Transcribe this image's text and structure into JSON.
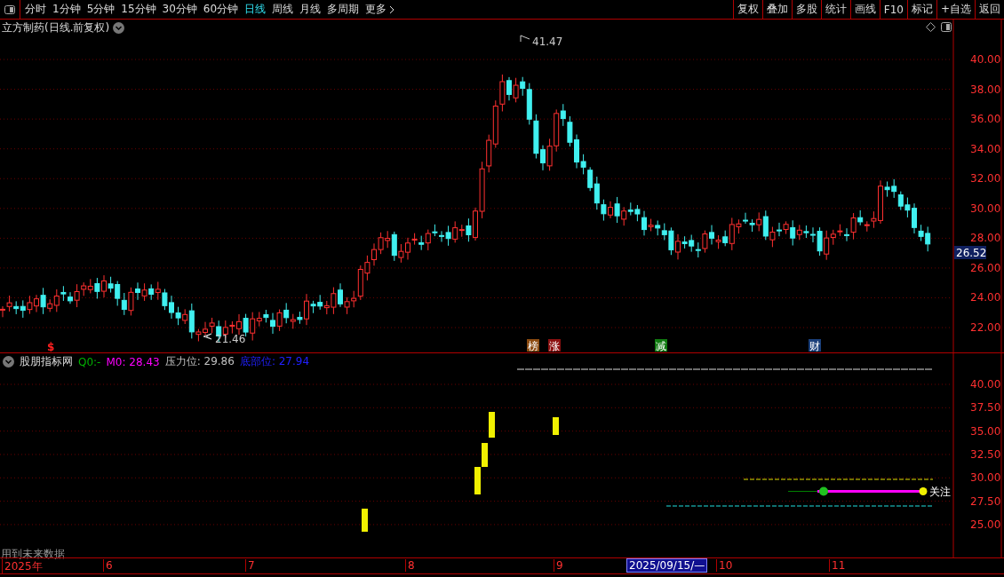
{
  "toolbar": {
    "periods": [
      {
        "label": "分时",
        "selected": false
      },
      {
        "label": "1分钟",
        "selected": false
      },
      {
        "label": "5分钟",
        "selected": false
      },
      {
        "label": "15分钟",
        "selected": false
      },
      {
        "label": "30分钟",
        "selected": false
      },
      {
        "label": "60分钟",
        "selected": false
      },
      {
        "label": "日线",
        "selected": true
      },
      {
        "label": "周线",
        "selected": false
      },
      {
        "label": "月线",
        "selected": false
      },
      {
        "label": "多周期",
        "selected": false
      },
      {
        "label": "更多",
        "selected": false
      }
    ],
    "buttons": [
      "复权",
      "叠加",
      "多股",
      "统计",
      "画线",
      "F10",
      "标记",
      "+自选",
      "返回"
    ]
  },
  "main_chart": {
    "title": "立方制药(日线.前复权)",
    "y_labels": [
      "40.00",
      "38.00",
      "36.00",
      "34.00",
      "32.00",
      "30.00",
      "28.00",
      "26.00",
      "24.00",
      "22.00"
    ],
    "current_price": "26.52",
    "high_label": "41.47",
    "low_label": "21.46",
    "marks": [
      {
        "text": "$",
        "kind": "symbol",
        "color": "#ff2020"
      },
      {
        "text": "榜",
        "kind": "badge",
        "color": "#8b4a10"
      },
      {
        "text": "涨",
        "kind": "badge",
        "color": "#8b1010"
      },
      {
        "text": "减",
        "kind": "badge",
        "color": "#107a10"
      },
      {
        "text": "财",
        "kind": "badge",
        "color": "#1a3f7a"
      }
    ]
  },
  "indicator": {
    "name": "股朋指标网",
    "legend": [
      {
        "text": "Q0:-",
        "color": "#00b000"
      },
      {
        "text": "M0: 28.43",
        "color": "#ff00ff"
      },
      {
        "text": "压力位: 29.86",
        "color": "#c0c0c0"
      },
      {
        "text": "底部位: 27.94",
        "color": "#2020ff"
      }
    ],
    "y_labels": [
      "40.00",
      "37.50",
      "35.00",
      "32.50",
      "30.00",
      "27.50",
      "25.00"
    ],
    "tag": "关注",
    "note": "用到未来数据"
  },
  "date_axis": [
    {
      "label": "2025年",
      "selected": false
    },
    {
      "label": "6",
      "selected": false
    },
    {
      "label": "7",
      "selected": false
    },
    {
      "label": "8",
      "selected": false
    },
    {
      "label": "9",
      "selected": false
    },
    {
      "label": "2025/09/15/—",
      "selected": true
    },
    {
      "label": "10",
      "selected": false
    },
    {
      "label": "11",
      "selected": false
    }
  ]
}
